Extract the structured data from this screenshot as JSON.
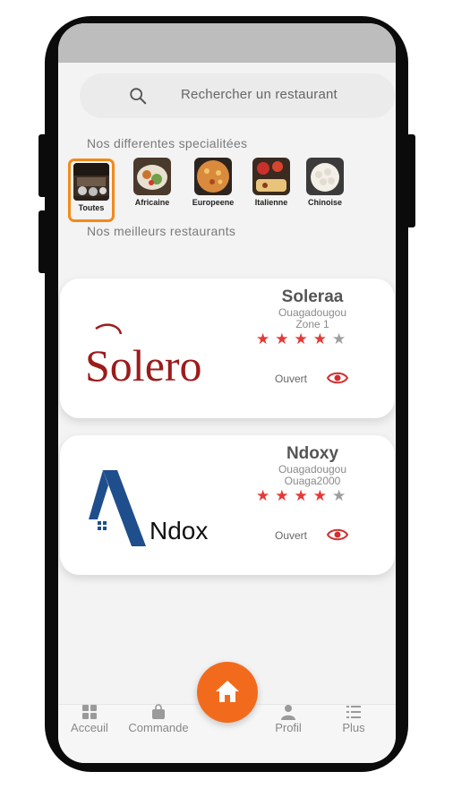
{
  "search": {
    "placeholder": "Rechercher un restaurant"
  },
  "sections": {
    "specialties_title": "Nos differentes specialitées",
    "best_title": "Nos meilleurs restaurants"
  },
  "categories": [
    {
      "label": "Toutes",
      "selected": true
    },
    {
      "label": "Africaine",
      "selected": false
    },
    {
      "label": "Europeene",
      "selected": false
    },
    {
      "label": "Italienne",
      "selected": false
    },
    {
      "label": "Chinoise",
      "selected": false
    }
  ],
  "restaurants": [
    {
      "name": "Soleraa",
      "city": "Ouagadougou",
      "zone": "Zone 1",
      "rating": 4,
      "max_rating": 5,
      "status": "Ouvert",
      "logo_text": "Solero"
    },
    {
      "name": "Ndoxy",
      "city": "Ouagadougou",
      "zone": "Ouaga2000",
      "rating": 4,
      "max_rating": 5,
      "status": "Ouvert",
      "logo_text": "Ndox"
    }
  ],
  "nav": {
    "items": [
      {
        "label": "Acceuil",
        "icon": "grid-icon"
      },
      {
        "label": "Commande",
        "icon": "bag-icon"
      },
      {
        "label": "Profil",
        "icon": "user-icon"
      },
      {
        "label": "Plus",
        "icon": "list-icon"
      }
    ],
    "fab_icon": "home-icon"
  },
  "colors": {
    "accent": "#f26b1d",
    "selected_border": "#f28a1a",
    "star": "#e53935",
    "eye": "#d32f2f"
  }
}
